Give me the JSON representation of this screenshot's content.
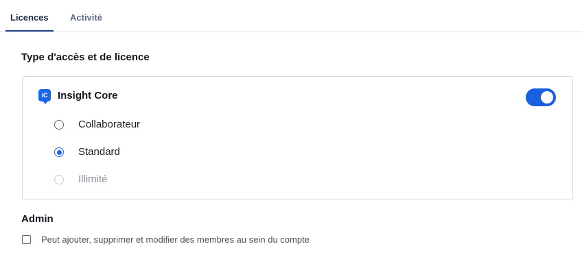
{
  "tabs": [
    {
      "label": "Licences",
      "active": true
    },
    {
      "label": "Activité",
      "active": false
    }
  ],
  "access_section": {
    "title": "Type d'accès et de licence"
  },
  "product": {
    "icon_text": "iC",
    "icon_name": "insight-core-logo-icon",
    "name": "Insight Core",
    "enabled": true,
    "options": [
      {
        "label": "Collaborateur",
        "selected": false,
        "disabled": false
      },
      {
        "label": "Standard",
        "selected": true,
        "disabled": false
      },
      {
        "label": "Illimité",
        "selected": false,
        "disabled": true
      }
    ]
  },
  "admin_section": {
    "title": "Admin",
    "checkbox_label": "Peut ajouter, supprimer et modifier des membres au sein du compte",
    "checked": false
  },
  "colors": {
    "accent": "#1a66e8",
    "toggle_on": "#1a5fe0",
    "tab_underline": "#1f3f8f"
  }
}
